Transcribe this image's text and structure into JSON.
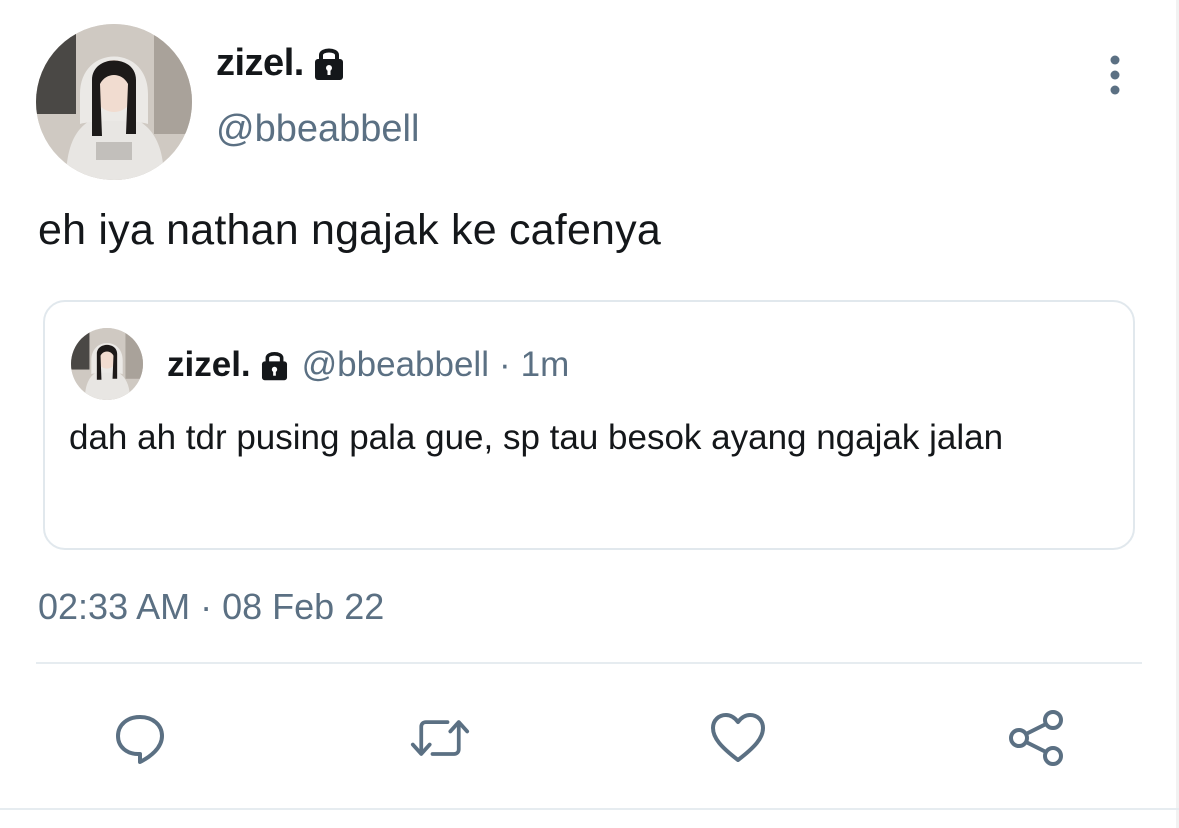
{
  "tweet": {
    "author": {
      "name": "zizel.",
      "handle": "@bbeabbell",
      "protected_icon": "lock-icon",
      "avatar": "avatar-photo"
    },
    "text": "eh iya nathan ngajak ke cafenya",
    "timestamp": {
      "time": "02:33 AM",
      "separator": "·",
      "date": "08 Feb 22"
    },
    "more_icon": "vertical-ellipsis-icon"
  },
  "quoted": {
    "name": "zizel.",
    "protected_icon": "lock-icon",
    "handle": "@bbeabbell",
    "separator": "·",
    "time": "1m",
    "text": "dah ah tdr pusing pala gue, sp tau besok ayang ngajak jalan"
  },
  "actions": [
    {
      "icon": "reply-icon"
    },
    {
      "icon": "retweet-icon"
    },
    {
      "icon": "like-icon"
    },
    {
      "icon": "share-icon"
    }
  ],
  "colors": {
    "text": "#14171a",
    "secondary": "#5b7083",
    "border": "#e1e8ed",
    "divider": "#e6ecf0"
  }
}
